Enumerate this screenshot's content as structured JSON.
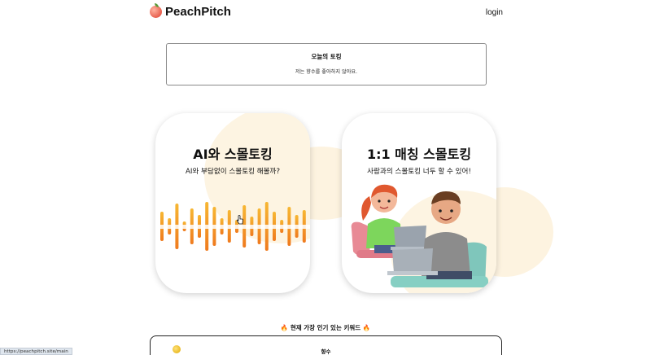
{
  "header": {
    "logo_text": "PeachPitch",
    "login_label": "login"
  },
  "topic": {
    "title": "오늘의 토킹",
    "text": "저는 향수를 좋아하지 않아요."
  },
  "cards": {
    "ai": {
      "title": "AI와 스몰토킹",
      "subtitle": "AI와 부담없이 스몰토킹 해볼까?"
    },
    "match": {
      "title": "1:1 매칭 스몰토킹",
      "subtitle": "사람과의 스몰토킹 너두 할 수 있어!"
    }
  },
  "keywords": {
    "title": "🔥 현재 가장 인기 있는 키워드 🔥",
    "items": [
      "향수"
    ]
  },
  "status_bar": {
    "url": "https://peachpitch.site/main"
  },
  "colors": {
    "accent_orange": "#f39a1f",
    "blob_cream": "#fdf3e0"
  },
  "icons": {
    "logo": "peach-icon",
    "cursor": "pointer-hand-icon",
    "keyword_badge": "gold-coin-icon"
  }
}
